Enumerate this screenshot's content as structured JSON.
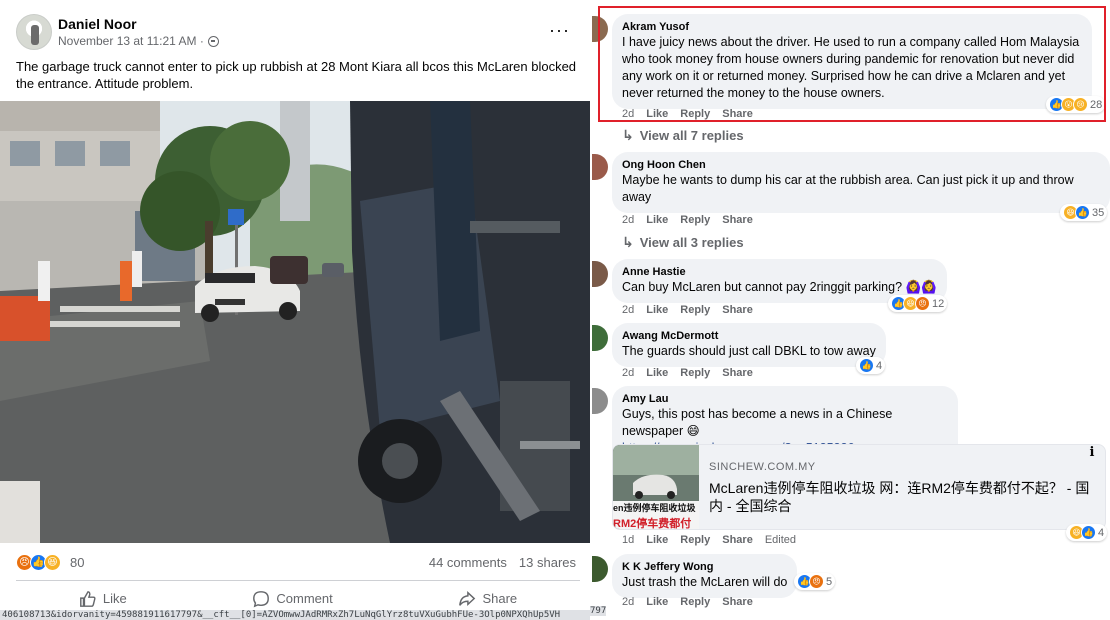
{
  "post": {
    "author": "Daniel Noor",
    "timestamp": "November 13 at 11:21 AM ·",
    "text": "The garbage truck cannot enter to pick up rubbish at 28 Mont Kiara all bcos this McLaren blocked the entrance. Attitude problem.",
    "reaction_count": "80",
    "comments_count": "44 comments",
    "shares_count": "13 shares",
    "actions": {
      "like": "Like",
      "comment": "Comment",
      "share": "Share"
    },
    "more_glyph": "···",
    "photo_caption": "Photo: garbage truck and white McLaren at building entrance"
  },
  "status_url": "406108713&idorvanity=459881911617797&__cft__[0]=AZVOmwwJAdRMRxZh7LuNqGlYrz8tuVXuGubhFUe-3Olp0NPXQhUp5VH",
  "status_suffix": "797",
  "comments": [
    {
      "name": "Akram Yusof",
      "text": "I have juicy news about the driver. He used to run a company called Hom Malaysia who took money from house owners during pandemic for renovation but never did any work on it or returned money. Surprised how he can drive a Mclaren and yet never returned the money to the house owners.",
      "time": "2d",
      "like": "Like",
      "reply": "Reply",
      "share": "Share",
      "reactions": "28",
      "view_replies": "View all 7 replies"
    },
    {
      "name": "Ong Hoon Chen",
      "text": "Maybe he wants to dump his car at the rubbish area. Can just pick it up and throw away",
      "time": "2d",
      "like": "Like",
      "reply": "Reply",
      "share": "Share",
      "reactions": "35",
      "view_replies": "View all 3 replies"
    },
    {
      "name": "Anne Hastie",
      "text": "Can buy McLaren but cannot pay 2ringgit parking? 🙆‍♀️🙆‍♀️",
      "time": "2d",
      "like": "Like",
      "reply": "Reply",
      "share": "Share",
      "reactions": "12"
    },
    {
      "name": "Awang McDermott",
      "text": "The guards should just call DBKL to tow away",
      "time": "2d",
      "like": "Like",
      "reply": "Reply",
      "share": "Share",
      "reactions": "4"
    },
    {
      "name": "Amy Lau",
      "text": "Guys, this post has become a news in a Chinese newspaper 😄",
      "link": "https://www.sinchew.com.my/?p=5125226",
      "time": "1d",
      "like": "Like",
      "reply": "Reply",
      "share": "Share",
      "edited": "Edited",
      "reactions": "4",
      "card": {
        "domain": "SINCHEW.COM.MY",
        "title": "McLaren违例停车阻收垃圾 网：连RM2停车费都付不起？ - 国内 - 全国综合",
        "thumb_text_1": "en违例停车阻收垃圾",
        "thumb_text_2": "RM2停车费都付",
        "info": "i"
      }
    },
    {
      "name": "K K Jeffery Wong",
      "text": "Just trash the McLaren will do",
      "time": "2d",
      "like": "Like",
      "reply": "Reply",
      "share": "Share",
      "reactions": "5"
    }
  ],
  "colors": {
    "facebook_blue": "#1877f2",
    "highlight_red": "#e0202a",
    "bubble_gray": "#f0f2f5",
    "secondary_text": "#65676b"
  }
}
